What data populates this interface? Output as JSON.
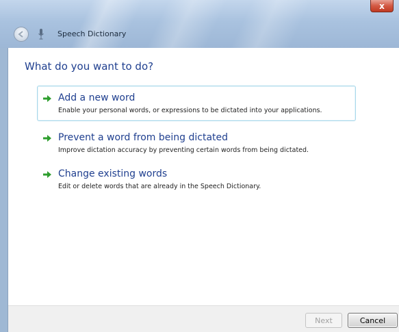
{
  "window": {
    "title": "Speech Dictionary",
    "close_label": "x"
  },
  "main": {
    "heading": "What do you want to do?",
    "options": [
      {
        "title": "Add a new word",
        "description": "Enable your personal words, or expressions to be dictated into your applications.",
        "icon": "green-arrow-icon",
        "highlighted": true
      },
      {
        "title": "Prevent a word from being dictated",
        "description": "Improve dictation accuracy by preventing certain words from being dictated.",
        "icon": "green-arrow-icon",
        "highlighted": false
      },
      {
        "title": "Change existing words",
        "description": "Edit or delete words that are already in the Speech Dictionary.",
        "icon": "green-arrow-icon",
        "highlighted": false
      }
    ]
  },
  "footer": {
    "next_label": "Next",
    "next_enabled": false,
    "cancel_label": "Cancel"
  },
  "colors": {
    "link_blue": "#1f3f8f",
    "arrow_green": "#2e9e2e",
    "highlight_border": "#a8d8ea",
    "close_red": "#c13a22"
  }
}
